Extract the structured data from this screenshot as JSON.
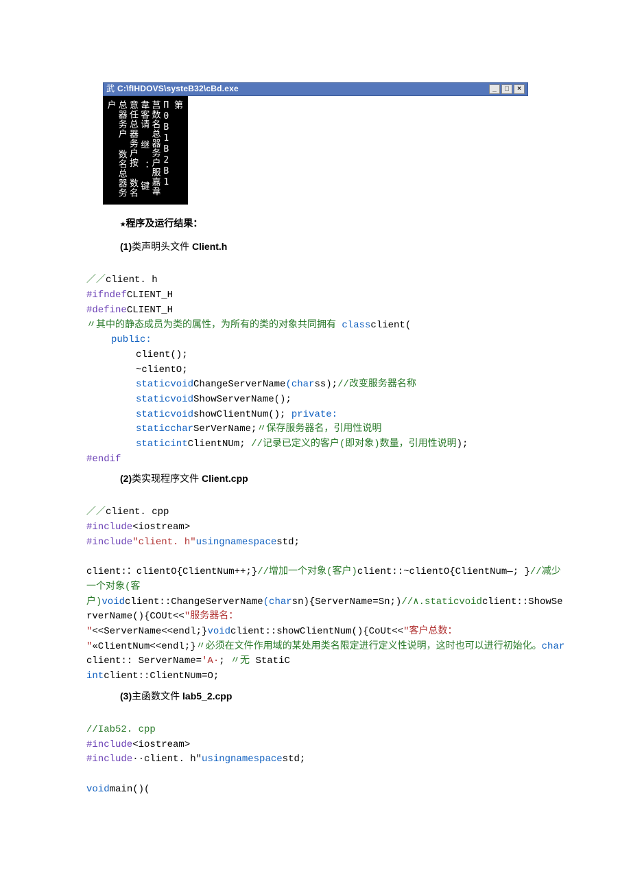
{
  "console": {
    "title_prefix": "武",
    "title_path": "C:\\fIHDOVS\\systeB32\\cBd.exe",
    "lines": "第\nП0B1B2B1\n莒数名总器务户服嘉韋韋客请\n继\n：\n键\n意任总器务户按\n数名总器务户\n数名总器务户"
  },
  "star_line": "★程序及运行结果：",
  "section1_num": "(1)",
  "section1_cn": "类声明头文件",
  "section1_file": " Client.h",
  "code1": {
    "l1a": "／／",
    "l1b": "client. h",
    "l2a": "#ifndef",
    "l2b": "CLIENT_H",
    "l3a": "#define",
    "l3b": "CLIENT_H",
    "l4a": "〃其中的静态成员为类的属性，为所有的类的对象共同拥有",
    "l4b": " class",
    "l4c": "client(",
    "l5": "public:",
    "l6": "client();",
    "l7": "~clientO;",
    "l8a": "staticvoid",
    "l8b": "ChangeServerName",
    "l8c": "(char",
    "l8d": "ss);",
    "l8e": "//改变服务器名称",
    "l9a": "staticvoid",
    "l9b": "ShowServerName();",
    "l10a": "staticvoid",
    "l10b": "showClientNum();",
    "l10c": " private:",
    "l11a": "staticchar",
    "l11b": "SerVerName;",
    "l11c": "〃保存服务器名，引用性说明",
    "l12a": "staticint",
    "l12b": "ClientNUm;",
    "l12c": " //记录已定义的客户(即对象)数量，引用性说明",
    "l12d": ");",
    "l13": "#endif"
  },
  "section2_num": "(2)",
  "section2_cn": "类实现程序文件",
  "section2_file": " Client.cpp",
  "code2": {
    "l1a": "／／",
    "l1b": "client. cpp",
    "l2a": "#include",
    "l2b": "<iostream>",
    "l3a": "#include",
    "l3b": "\"client. h\"",
    "l3c": "usingnamespace",
    "l3d": "std;",
    "l5a": "client:：clientO{ClientNum++;}",
    "l5b": "//增加一个对象(客户)",
    "l5c": "client::~clientO{ClientNum—; }",
    "l5d": "//减少一个对象(客",
    "l6a": "户)",
    "l6b": "void",
    "l6c": "client::ChangeServerName",
    "l6d": "(char",
    "l6e": "sn){ServerName=Sn;)",
    "l6f": "//∧.staticvoid",
    "l6g": "client::ShowServerName(){COUt<<",
    "l6h": "\"服务器名：",
    "l7a": "\"",
    "l7b": "<<ServerName<<endl;}",
    "l7c": "void",
    "l7d": "client::showClientNum(){CoUt<<",
    "l7e": "\"客户总数：",
    "l8a": "\"",
    "l8b": "«ClientNum<<endl;}",
    "l8c": "〃必须在文件作用域的某处用类名限定进行定义性说明，这时也可以进行初始化。",
    "l8d": "char",
    "l8e": "client:: ServerName=",
    "l8f": "'A·",
    "l8g": ";",
    "l8h": " 〃无",
    "l8i": " StatiC",
    "l9a": "int",
    "l9b": "client::ClientN∪m=O;"
  },
  "section3_num": "(3)",
  "section3_cn": "主函数文件",
  "section3_file": " lab5_2.cpp",
  "code3": {
    "l1": "//Iab52. cpp",
    "l2a": "#include",
    "l2b": "<iostream>",
    "l3a": "#include",
    "l3b": "··",
    "l3c": "client. h\"",
    "l3d": "usingnamespace",
    "l3e": "std;",
    "l5a": "void",
    "l5b": "main()("
  }
}
